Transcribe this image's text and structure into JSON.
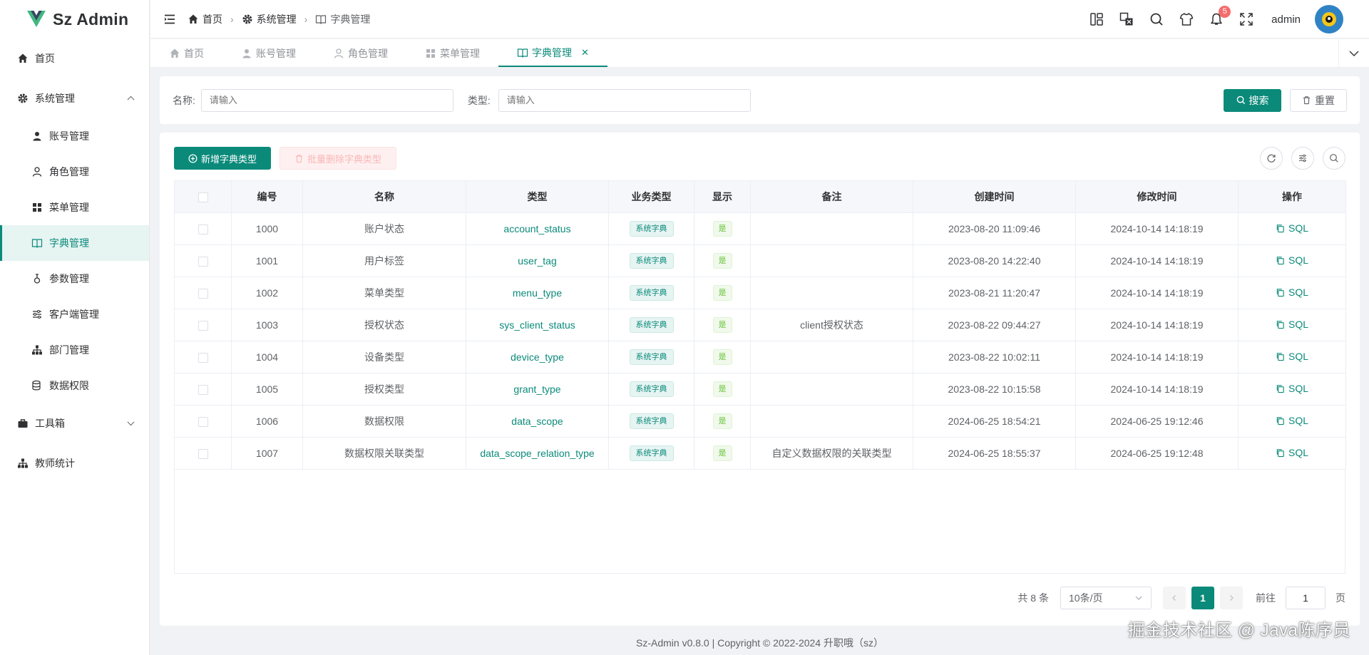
{
  "app": {
    "name": "Sz Admin"
  },
  "sidebar": {
    "items": [
      {
        "label": "首页"
      },
      {
        "label": "系统管理"
      },
      {
        "label": "工具箱"
      },
      {
        "label": "教师统计"
      }
    ],
    "system_children": [
      {
        "label": "账号管理"
      },
      {
        "label": "角色管理"
      },
      {
        "label": "菜单管理"
      },
      {
        "label": "字典管理"
      },
      {
        "label": "参数管理"
      },
      {
        "label": "客户端管理"
      },
      {
        "label": "部门管理"
      },
      {
        "label": "数据权限"
      }
    ]
  },
  "header": {
    "breadcrumb": [
      "首页",
      "系统管理",
      "字典管理"
    ],
    "notification_count": "5",
    "username": "admin"
  },
  "tabs": [
    {
      "label": "首页"
    },
    {
      "label": "账号管理"
    },
    {
      "label": "角色管理"
    },
    {
      "label": "菜单管理"
    },
    {
      "label": "字典管理"
    }
  ],
  "search": {
    "name_label": "名称:",
    "name_placeholder": "请输入",
    "type_label": "类型:",
    "type_placeholder": "请输入",
    "search_btn": "搜索",
    "reset_btn": "重置"
  },
  "toolbar": {
    "add_btn": "新增字典类型",
    "batch_delete_btn": "批量删除字典类型"
  },
  "table": {
    "columns": [
      "编号",
      "名称",
      "类型",
      "业务类型",
      "显示",
      "备注",
      "创建时间",
      "修改时间",
      "操作"
    ],
    "rows": [
      {
        "id": "1000",
        "name": "账户状态",
        "type": "account_status",
        "biz": "系统字典",
        "show": "是",
        "remark": "",
        "created": "2023-08-20 11:09:46",
        "updated": "2024-10-14 14:18:19",
        "action": "SQL"
      },
      {
        "id": "1001",
        "name": "用户标签",
        "type": "user_tag",
        "biz": "系统字典",
        "show": "是",
        "remark": "",
        "created": "2023-08-20 14:22:40",
        "updated": "2024-10-14 14:18:19",
        "action": "SQL"
      },
      {
        "id": "1002",
        "name": "菜单类型",
        "type": "menu_type",
        "biz": "系统字典",
        "show": "是",
        "remark": "",
        "created": "2023-08-21 11:20:47",
        "updated": "2024-10-14 14:18:19",
        "action": "SQL"
      },
      {
        "id": "1003",
        "name": "授权状态",
        "type": "sys_client_status",
        "biz": "系统字典",
        "show": "是",
        "remark": "client授权状态",
        "created": "2023-08-22 09:44:27",
        "updated": "2024-10-14 14:18:19",
        "action": "SQL"
      },
      {
        "id": "1004",
        "name": "设备类型",
        "type": "device_type",
        "biz": "系统字典",
        "show": "是",
        "remark": "",
        "created": "2023-08-22 10:02:11",
        "updated": "2024-10-14 14:18:19",
        "action": "SQL"
      },
      {
        "id": "1005",
        "name": "授权类型",
        "type": "grant_type",
        "biz": "系统字典",
        "show": "是",
        "remark": "",
        "created": "2023-08-22 10:15:58",
        "updated": "2024-10-14 14:18:19",
        "action": "SQL"
      },
      {
        "id": "1006",
        "name": "数据权限",
        "type": "data_scope",
        "biz": "系统字典",
        "show": "是",
        "remark": "",
        "created": "2024-06-25 18:54:21",
        "updated": "2024-06-25 19:12:46",
        "action": "SQL"
      },
      {
        "id": "1007",
        "name": "数据权限关联类型",
        "type": "data_scope_relation_type",
        "biz": "系统字典",
        "show": "是",
        "remark": "自定义数据权限的关联类型",
        "created": "2024-06-25 18:55:37",
        "updated": "2024-06-25 19:12:48",
        "action": "SQL"
      }
    ]
  },
  "pagination": {
    "total": "共 8 条",
    "page_size": "10条/页",
    "current": "1",
    "goto_label": "前往",
    "goto_value": "1",
    "page_suffix": "页"
  },
  "footer": {
    "text": "Sz-Admin v0.8.0 | Copyright © 2022-2024 升职哦（sz）"
  },
  "watermark": {
    "text": "掘金技术社区 @ Java陈序员"
  },
  "colors": {
    "primary": "#0b8a7a",
    "danger": "#f56c6c",
    "success": "#67c23a"
  }
}
